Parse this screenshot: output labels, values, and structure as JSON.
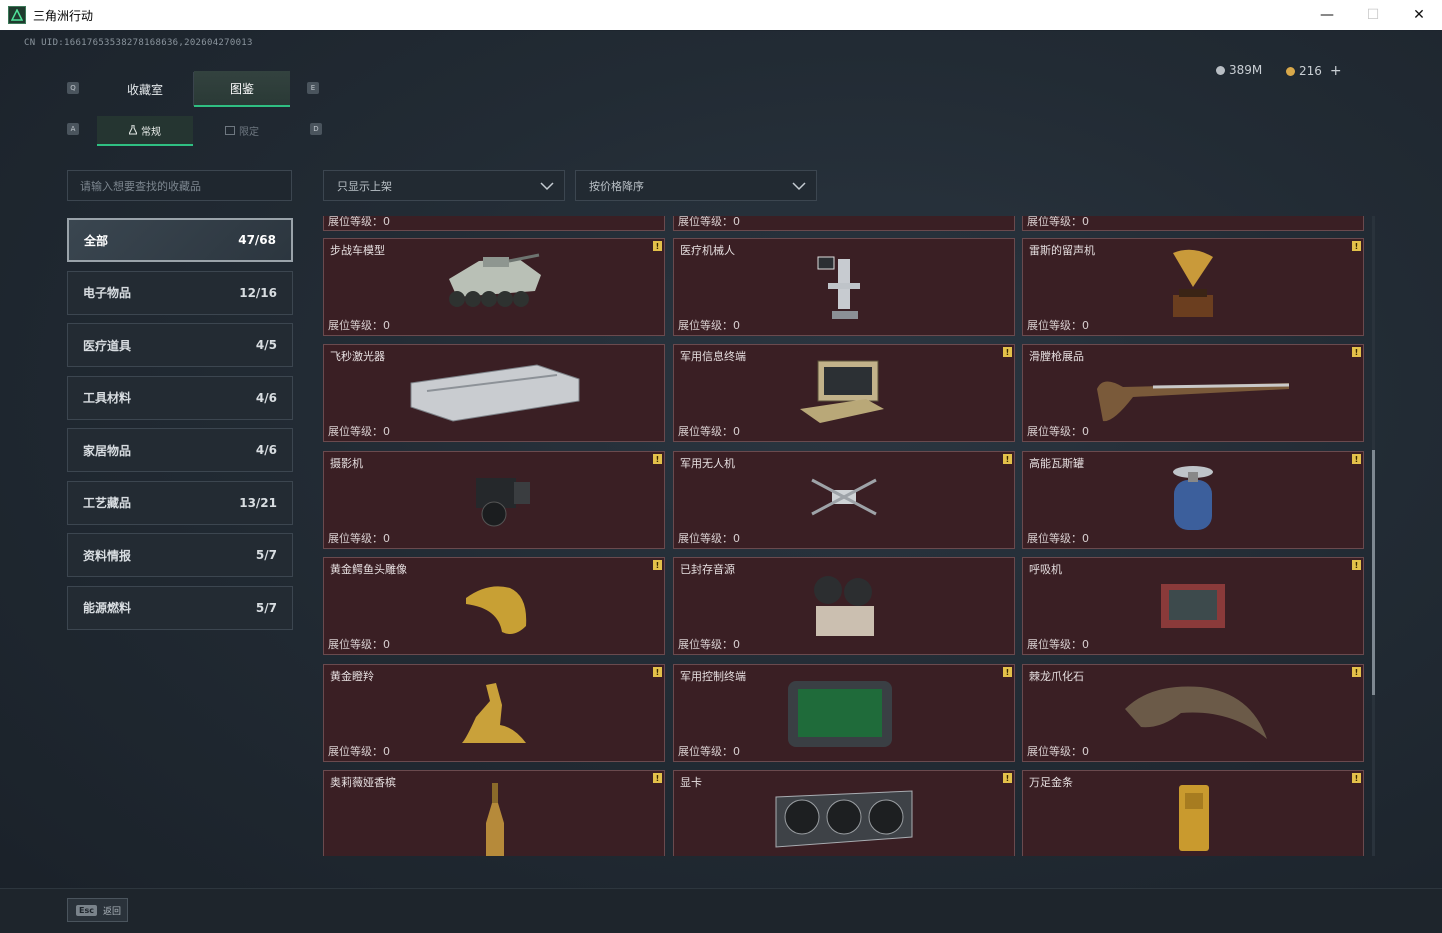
{
  "window": {
    "title": "三角洲行动",
    "min": "—",
    "max": "☐",
    "close": "✕"
  },
  "uid": "CN UID:16617653538278168636,202604270013",
  "currency": {
    "silver": "389M",
    "gold": "216",
    "plus": "+"
  },
  "keys": {
    "tab_left": "Q",
    "tab_right": "E",
    "sub_left": "A",
    "sub_right": "D"
  },
  "tabs": {
    "collection": "收藏室",
    "catalog": "图鉴"
  },
  "subtabs": {
    "normal": "常规",
    "limited": "限定"
  },
  "search": {
    "placeholder": "请输入想要查找的收藏品"
  },
  "filters": {
    "shelf": "只显示上架",
    "sort": "按价格降序"
  },
  "categories": [
    {
      "label": "全部",
      "count": "47/68"
    },
    {
      "label": "电子物品",
      "count": "12/16"
    },
    {
      "label": "医疗道具",
      "count": "4/5"
    },
    {
      "label": "工具材料",
      "count": "4/6"
    },
    {
      "label": "家居物品",
      "count": "4/6"
    },
    {
      "label": "工艺藏品",
      "count": "13/21"
    },
    {
      "label": "资料情报",
      "count": "5/7"
    },
    {
      "label": "能源燃料",
      "count": "5/7"
    }
  ],
  "level_label": "展位等级：0",
  "badge": "!",
  "items": [
    {
      "name": "步战车模型",
      "icon": "ifv-model-icon",
      "badge": true
    },
    {
      "name": "医疗机械人",
      "icon": "medical-robot-icon",
      "badge": false
    },
    {
      "name": "雷斯的留声机",
      "icon": "gramophone-icon",
      "badge": true
    },
    {
      "name": "飞秒激光器",
      "icon": "laser-case-icon",
      "badge": false
    },
    {
      "name": "军用信息终端",
      "icon": "military-terminal-icon",
      "badge": true
    },
    {
      "name": "滑膛枪展品",
      "icon": "musket-icon",
      "badge": true
    },
    {
      "name": "摄影机",
      "icon": "camera-icon",
      "badge": true
    },
    {
      "name": "军用无人机",
      "icon": "drone-icon",
      "badge": true
    },
    {
      "name": "高能瓦斯罐",
      "icon": "gas-tank-icon",
      "badge": true
    },
    {
      "name": "黄金鳄鱼头雕像",
      "icon": "gold-croc-icon",
      "badge": true
    },
    {
      "name": "已封存音源",
      "icon": "reel-recorder-icon",
      "badge": false
    },
    {
      "name": "呼吸机",
      "icon": "ventilator-icon",
      "badge": true
    },
    {
      "name": "黄金瞪羚",
      "icon": "gold-gazelle-icon",
      "badge": true
    },
    {
      "name": "军用控制终端",
      "icon": "control-terminal-icon",
      "badge": true
    },
    {
      "name": "棘龙爪化石",
      "icon": "claw-fossil-icon",
      "badge": true
    },
    {
      "name": "奥莉薇娅香槟",
      "icon": "champagne-icon",
      "badge": true
    },
    {
      "name": "显卡",
      "icon": "gpu-icon",
      "badge": true
    },
    {
      "name": "万足金条",
      "icon": "gold-bar-icon",
      "badge": true
    }
  ],
  "footer": {
    "esc_key": "Esc",
    "back": "返回"
  },
  "colors": {
    "accent": "#2fbf82",
    "card_bg": "#3a1f24",
    "badge": "#e3c14a"
  }
}
